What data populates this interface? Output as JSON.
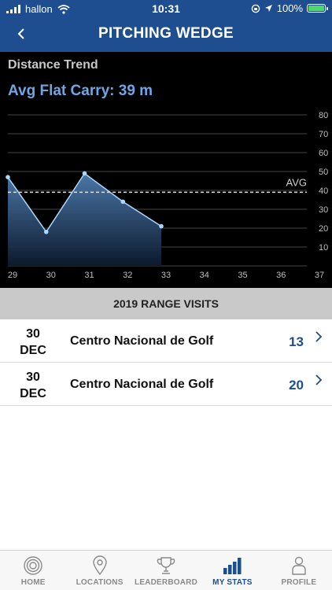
{
  "status": {
    "carrier": "hallon",
    "time": "10:31",
    "battery": "100%"
  },
  "nav": {
    "title": "PITCHING WEDGE",
    "back_icon": "chevron-left-icon"
  },
  "chart_section": {
    "title": "Distance Trend",
    "avg_label": "Avg Flat Carry: 39 m"
  },
  "chart_data": {
    "type": "area",
    "x": [
      29,
      30,
      31,
      32,
      33
    ],
    "values": [
      47,
      18,
      49,
      34,
      21
    ],
    "x_ticks": [
      "29",
      "30",
      "31",
      "32",
      "33",
      "34",
      "35",
      "36",
      "37"
    ],
    "y_ticks": [
      "10",
      "20",
      "30",
      "40",
      "50",
      "60",
      "70",
      "80"
    ],
    "xlim": [
      29,
      37
    ],
    "ylim": [
      0,
      80
    ],
    "avg_value": 39,
    "avg_text": "AVG",
    "grid": true,
    "line_color": "#a9d8ff",
    "background": "#000000"
  },
  "visits": {
    "header": "2019 RANGE VISITS",
    "rows": [
      {
        "day": "30",
        "month": "DEC",
        "place": "Centro Nacional de Golf",
        "value": "13"
      },
      {
        "day": "30",
        "month": "DEC",
        "place": "Centro Nacional de Golf",
        "value": "20"
      }
    ]
  },
  "tabs": [
    {
      "label": "HOME",
      "icon": "home-icon"
    },
    {
      "label": "LOCATIONS",
      "icon": "location-pin-icon"
    },
    {
      "label": "LEADERBOARD",
      "icon": "trophy-icon"
    },
    {
      "label": "MY STATS",
      "icon": "bar-chart-icon",
      "active": true
    },
    {
      "label": "PROFILE",
      "icon": "profile-icon"
    }
  ],
  "colors": {
    "brand": "#1e4e8f",
    "accent": "#6fa7e6"
  }
}
